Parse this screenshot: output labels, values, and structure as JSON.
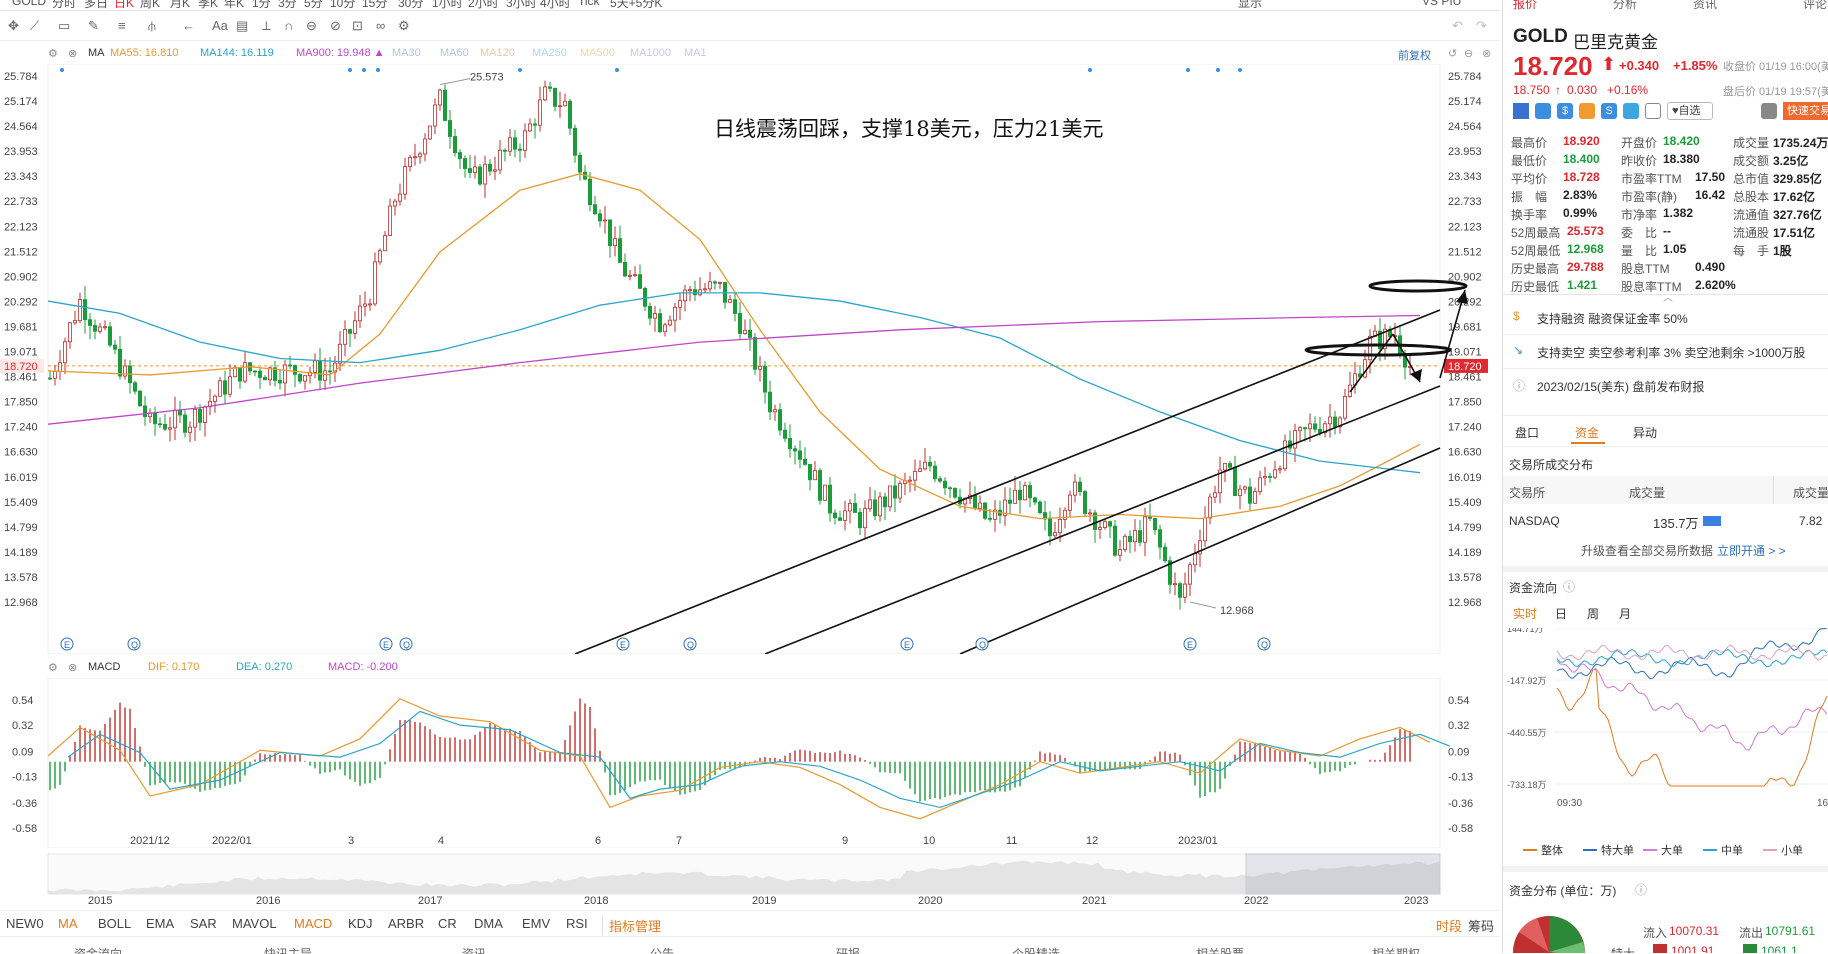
{
  "top_tabs": [
    "GOLD",
    "分时",
    "多日",
    "日K",
    "周K",
    "月K",
    "季K",
    "年K",
    "1分",
    "3分",
    "5分",
    "10分",
    "15分",
    "30分",
    "1小时",
    "2小时",
    "3小时",
    "4小时",
    "Tick",
    "5天+5分K"
  ],
  "top_right": [
    "显示",
    "VS PIU"
  ],
  "ma_legend": {
    "name": "MA",
    "items": [
      {
        "label": "MA55:",
        "value": "16.810",
        "color": "#e79a2f"
      },
      {
        "label": "MA144:",
        "value": "16.119",
        "color": "#2aa5c9"
      },
      {
        "label": "MA900:",
        "value": "19.948",
        "color": "#c045c8"
      },
      {
        "label": "MA30",
        "value": "",
        "color": "#a9c8e8"
      },
      {
        "label": "MA60",
        "value": "",
        "color": "#a9c8e8"
      },
      {
        "label": "MA120",
        "value": "",
        "color": "#f2c4a0"
      },
      {
        "label": "MA250",
        "value": "",
        "color": "#a9d8f0"
      },
      {
        "label": "MA500",
        "value": "",
        "color": "#f2d6a0"
      },
      {
        "label": "MA1000",
        "value": "",
        "color": "#c8c8e8"
      },
      {
        "label": "MA1",
        "value": "",
        "color": "#c8c8e8"
      }
    ],
    "adjust": "前复权"
  },
  "annotation": "日线震荡回踩，支撑18美元，压力21美元",
  "price_axis": [
    "25.784",
    "25.174",
    "24.564",
    "23.953",
    "23.343",
    "22.733",
    "22.123",
    "21.512",
    "20.902",
    "20.292",
    "19.681",
    "19.071",
    "18.461",
    "17.850",
    "17.240",
    "16.630",
    "16.019",
    "15.409",
    "14.799",
    "14.189",
    "13.578",
    "12.968"
  ],
  "current_price_label": "18.720",
  "high_label": "25.573",
  "low_label": "12.968",
  "macd_legend": {
    "name": "MACD",
    "dif": "DIF: 0.170",
    "dea": "DEA: 0.270",
    "macd": "MACD: -0.200"
  },
  "macd_axis": [
    "0.54",
    "0.32",
    "0.09",
    "-0.13",
    "-0.36",
    "-0.58"
  ],
  "date_axis": [
    "2021/12",
    "2022/01",
    "3",
    "4",
    "6",
    "7",
    "9",
    "10",
    "11",
    "12",
    "2023/01"
  ],
  "year_axis": [
    "2015",
    "2016",
    "2017",
    "2018",
    "2019",
    "2020",
    "2021",
    "2022",
    "2023"
  ],
  "indicators": [
    "NEW0",
    "MA",
    "BOLL",
    "EMA",
    "SAR",
    "MAVOL",
    "MACD",
    "KDJ",
    "ARBR",
    "CR",
    "DMA",
    "EMV",
    "RSI",
    "指标管理"
  ],
  "indicator_right": [
    "时段",
    "筹码"
  ],
  "bottom_tabs": [
    "资金流向",
    "快讯主导",
    "资讯",
    "公告",
    "研报",
    "个股精选",
    "相关股票",
    "相关期权"
  ],
  "stock": {
    "code": "GOLD",
    "name": "巴里克黄金",
    "price": "18.720",
    "change": "+0.340",
    "change_pct": "+1.85%",
    "close_note": "收盘价 01/19 16:00(美东)",
    "after_price": "18.750",
    "after_change": "0.030",
    "after_pct": "+0.16%",
    "after_note": "盘后价 01/19 19:57(美东)",
    "watch": "自选",
    "quick_trade": "快速交易"
  },
  "stats": [
    {
      "label": "最高价",
      "value": "18.920",
      "color": "red"
    },
    {
      "label": "开盘价",
      "value": "18.420",
      "color": "green"
    },
    {
      "label": "成交量",
      "value": "1735.24万",
      "color": "black"
    },
    {
      "label": "最低价",
      "value": "18.400",
      "color": "green"
    },
    {
      "label": "昨收价",
      "value": "18.380",
      "color": "black"
    },
    {
      "label": "成交额",
      "value": "3.25亿",
      "color": "black"
    },
    {
      "label": "平均价",
      "value": "18.728",
      "color": "red"
    },
    {
      "label": "市盈率TTM",
      "value": "17.50",
      "color": "black"
    },
    {
      "label": "总市值",
      "value": "329.85亿",
      "color": "black"
    },
    {
      "label": "振　幅",
      "value": "2.83%",
      "color": "black"
    },
    {
      "label": "市盈率(静)",
      "value": "16.42",
      "color": "black"
    },
    {
      "label": "总股本",
      "value": "17.62亿",
      "color": "black"
    },
    {
      "label": "换手率",
      "value": "0.99%",
      "color": "black"
    },
    {
      "label": "市净率",
      "value": "1.382",
      "color": "black"
    },
    {
      "label": "流通值",
      "value": "327.76亿",
      "color": "black"
    },
    {
      "label": "52周最高",
      "value": "25.573",
      "color": "red"
    },
    {
      "label": "委　比",
      "value": "--",
      "color": "black"
    },
    {
      "label": "流通股",
      "value": "17.51亿",
      "color": "black"
    },
    {
      "label": "52周最低",
      "value": "12.968",
      "color": "green"
    },
    {
      "label": "量　比",
      "value": "1.05",
      "color": "black"
    },
    {
      "label": "每　手",
      "value": "1股",
      "color": "black"
    },
    {
      "label": "历史最高",
      "value": "29.788",
      "color": "red"
    },
    {
      "label": "股息TTM",
      "value": "0.490",
      "color": "black"
    },
    {
      "label": "",
      "value": "",
      "color": "black"
    },
    {
      "label": "历史最低",
      "value": "1.421",
      "color": "green"
    },
    {
      "label": "股息率TTM",
      "value": "2.620%",
      "color": "black"
    },
    {
      "label": "",
      "value": "",
      "color": "black"
    }
  ],
  "info_rows": [
    {
      "icon": "dollar-icon",
      "text": "支持融资 融资保证金率 50%"
    },
    {
      "icon": "short-icon",
      "text": "支持卖空 卖空参考利率 3% 卖空池剩余 >1000万股"
    },
    {
      "icon": "info-icon",
      "text": "2023/02/15(美东) 盘前发布财报"
    }
  ],
  "sub_tabs": [
    "盘口",
    "资金",
    "异动"
  ],
  "exchange": {
    "title": "交易所成交分布",
    "headers": [
      "交易所",
      "成交量",
      "成交量"
    ],
    "row": {
      "name": "NASDAQ",
      "volume": "135.7万",
      "right": "7.82"
    },
    "upgrade": "升级查看全部交易所数据",
    "open": "立即开通 > >"
  },
  "fund_flow": {
    "title": "资金流向",
    "tabs": [
      "实时",
      "日",
      "周",
      "月"
    ],
    "axis": [
      "144.71万",
      "-147.92万",
      "-440.55万",
      "-733.18万"
    ],
    "time_start": "09:30",
    "time_end": "16",
    "legend": [
      {
        "name": "整体",
        "color": "#e07b1f"
      },
      {
        "name": "特大单",
        "color": "#2f6fb8"
      },
      {
        "name": "大单",
        "color": "#d07bd8"
      },
      {
        "name": "中单",
        "color": "#2aa5c9"
      },
      {
        "name": "小单",
        "color": "#e0a0c0"
      }
    ]
  },
  "distribution": {
    "title": "资金分布 (单位：万)",
    "inflow_label": "流入",
    "inflow": "10070.31",
    "outflow_label": "流出",
    "outflow": "10791.61",
    "row2_in": "1001.91",
    "row2_out": "1061.1",
    "row_label": "特大"
  }
}
